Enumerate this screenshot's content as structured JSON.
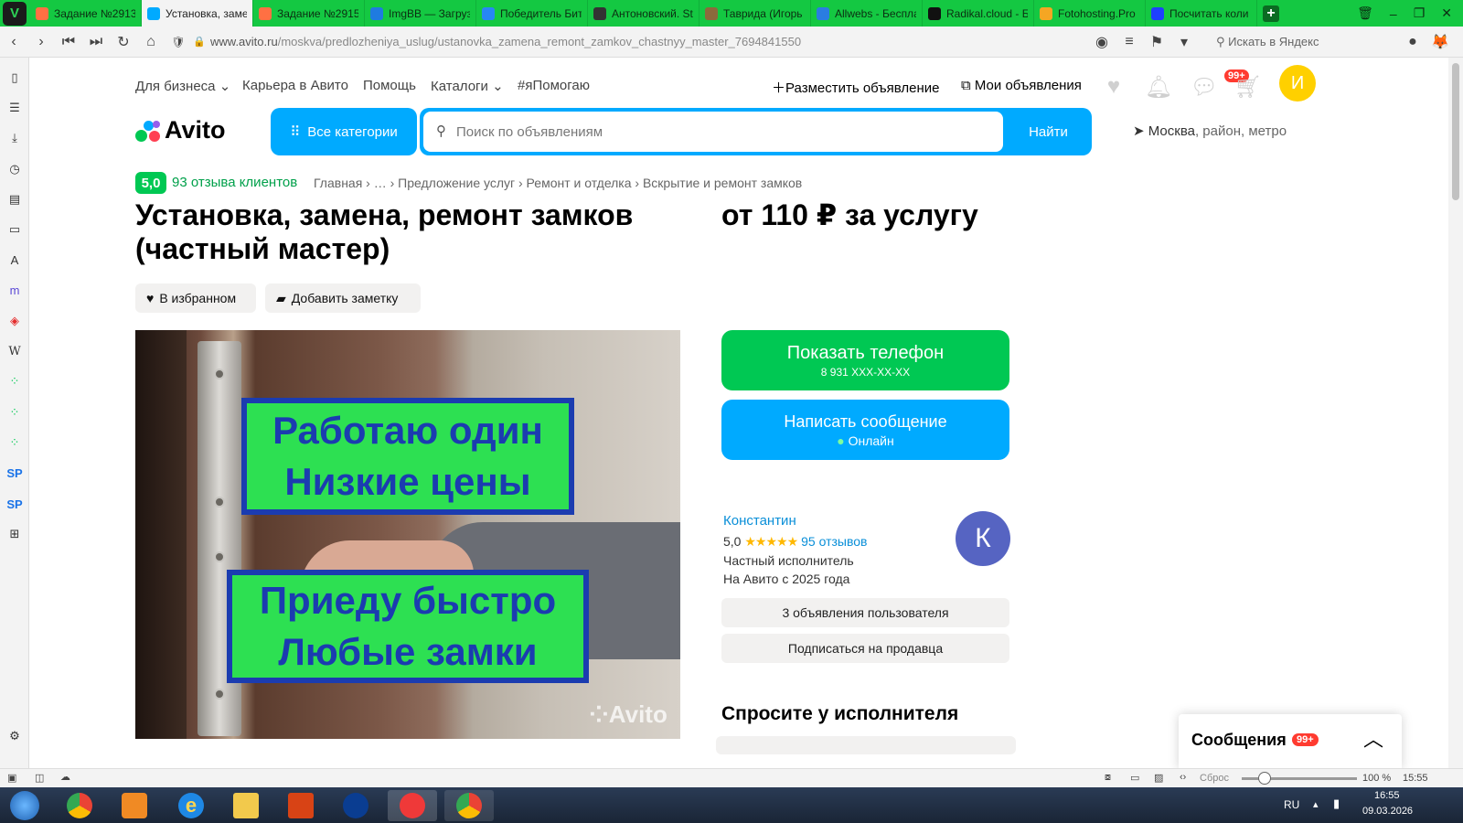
{
  "browser": {
    "tabs": [
      {
        "title": "Задание №2913",
        "icon": "p-icon",
        "color": "#ff7043"
      },
      {
        "title": "Установка, заме",
        "icon": "avito-icon",
        "color": "#00aaff",
        "active": true
      },
      {
        "title": "Задание №2915",
        "icon": "p-icon",
        "color": "#ff7043"
      },
      {
        "title": "ImgBB — Загруз",
        "icon": "imgbb-icon",
        "color": "#1f7be0"
      },
      {
        "title": "Победитель Бит",
        "icon": "vk-icon",
        "color": "#2787f5"
      },
      {
        "title": "Антоновский. St",
        "icon": "lib-icon",
        "color": "#333333"
      },
      {
        "title": "Таврида (Игорь",
        "icon": "book-icon",
        "color": "#8c6a3c"
      },
      {
        "title": "Allwebs - Беспла",
        "icon": "globe-icon",
        "color": "#2a7de1"
      },
      {
        "title": "Radikal.cloud - Б",
        "icon": "r-icon",
        "color": "#111111"
      },
      {
        "title": "Fotohosting.Pro",
        "icon": "f-icon",
        "color": "#f5a623"
      },
      {
        "title": "Посчитать коли",
        "icon": "dot-icon",
        "color": "#1e40ff"
      }
    ],
    "url_host": "www.avito.ru",
    "url_path": "/moskva/predlozheniya_uslug/ustanovka_zamena_remont_zamkov_chastnyy_master_7694841550",
    "yandex_placeholder": "Искать в Яндекс",
    "zoom": "100 %",
    "reset_label": "Сброс",
    "time_status": "15:55"
  },
  "header": {
    "links": [
      "Для бизнеса",
      "Карьера в Авито",
      "Помощь",
      "Каталоги",
      "#яПомогаю"
    ],
    "post_ad": "Разместить объявление",
    "my_ads": "Мои объявления",
    "messages_badge": "99+",
    "user_initial": "И",
    "logo_text": "Avito",
    "all_categories": "Все категории",
    "search_placeholder": "Поиск по объявлениям",
    "search_button": "Найти",
    "location_city": "Москва",
    "location_rest": ", район, метро"
  },
  "listing": {
    "rating": "5,0",
    "reviews_link": "93 отзыва клиентов",
    "breadcrumbs": "Главная  ›  …  ›  Предложение услуг  ›  Ремонт и отделка  ›  Вскрытие и ремонт замков",
    "title": "Установка, замена, ремонт замков (частный мастер)",
    "price": "от 110 ₽ за услугу",
    "favorite_btn": "В избранном",
    "note_btn": "Добавить заметку",
    "photo_text_top_1": "Работаю один",
    "photo_text_top_2": "Низкие цены",
    "photo_text_bottom_1": "Приеду быстро",
    "photo_text_bottom_2": "Любые замки",
    "photo_watermark": "Avito"
  },
  "actions": {
    "show_phone": "Показать телефон",
    "phone_masked": "8 931 XXX-XX-XX",
    "write_message": "Написать сообщение",
    "online": "Онлайн"
  },
  "seller": {
    "name": "Константин",
    "rating": "5,0",
    "stars": "★★★★★",
    "reviews": "95 отзывов",
    "type": "Частный исполнитель",
    "since": "На Авито с 2025 года",
    "avatar_letter": "К",
    "ads_btn": "3 объявления пользователя",
    "subscribe_btn": "Подписаться на продавца",
    "ask_header": "Спросите у исполнителя"
  },
  "messages_panel": {
    "title": "Сообщения",
    "badge": "99+"
  },
  "taskbar": {
    "lang": "RU",
    "time": "16:55",
    "date": "09.03.2026"
  }
}
